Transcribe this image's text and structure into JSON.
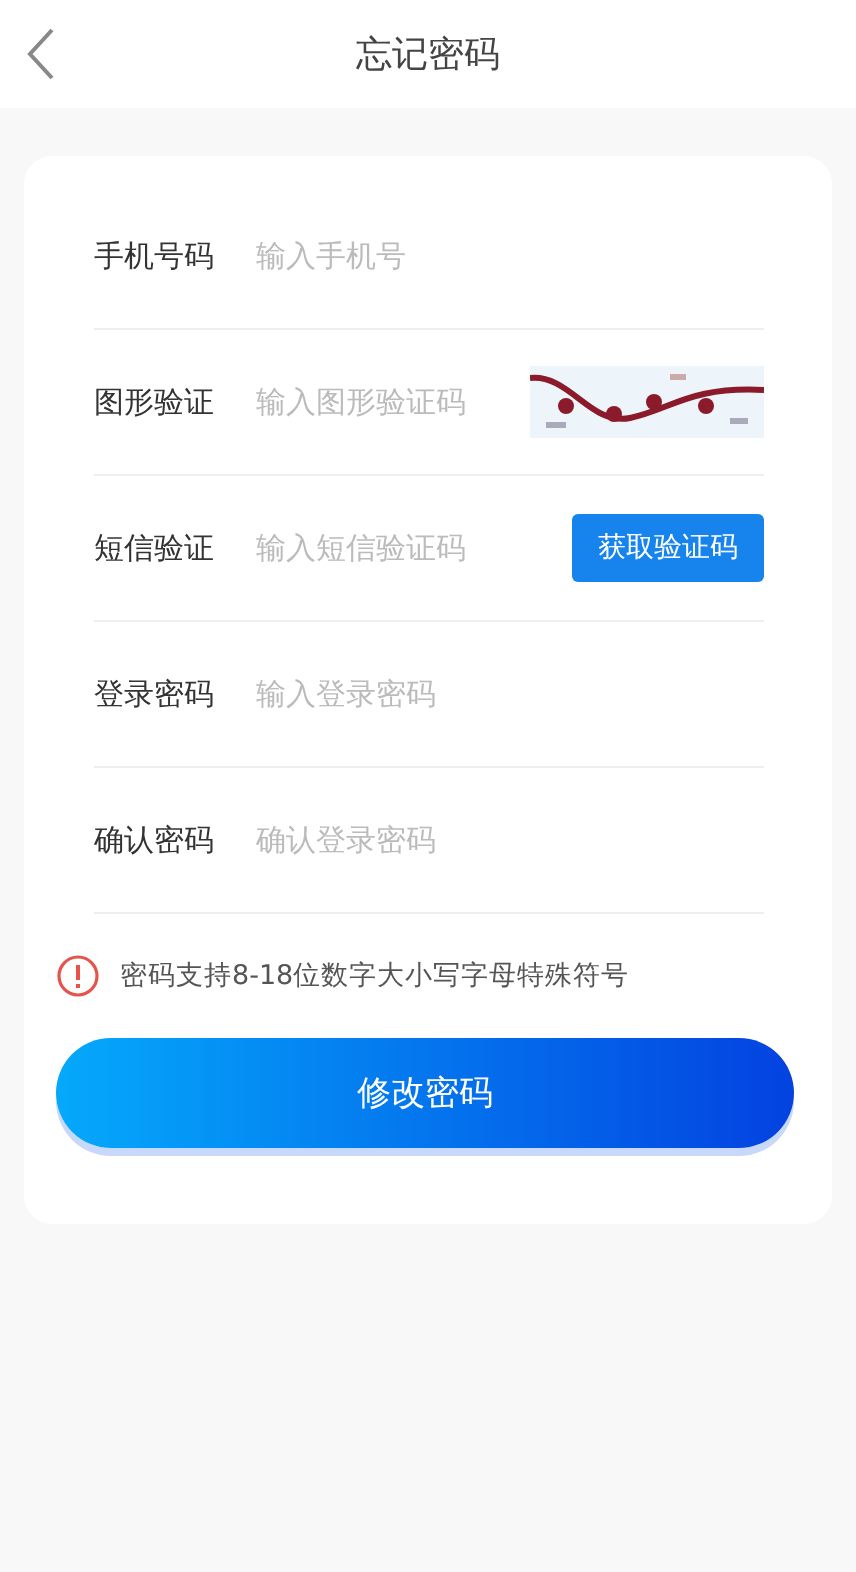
{
  "header": {
    "title": "忘记密码"
  },
  "fields": [
    {
      "kind": "plain",
      "label": "手机号码",
      "placeholder": "输入手机号"
    },
    {
      "kind": "captcha",
      "label": "图形验证",
      "placeholder": "输入图形验证码"
    },
    {
      "kind": "sms",
      "label": "短信验证",
      "placeholder": "输入短信验证码",
      "button": "获取验证码"
    },
    {
      "kind": "plain",
      "label": "登录密码",
      "placeholder": "输入登录密码"
    },
    {
      "kind": "plain",
      "label": "确认密码",
      "placeholder": "确认登录密码"
    }
  ],
  "hint": "密码支持8-18位数字大小写字母特殊符号",
  "submit": "修改密码"
}
